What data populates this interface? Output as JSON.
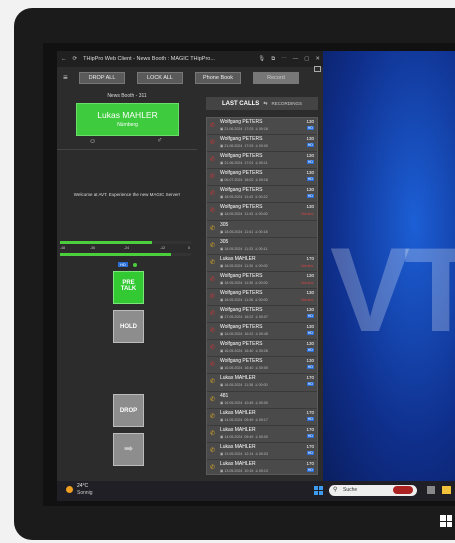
{
  "window": {
    "title": "THipPro Web Client - News Booth : MAGIC THipPro...",
    "toolbar": {
      "drop_all": "DROP ALL",
      "lock_all": "LOCK ALL",
      "phone_book": "Phone Book",
      "record": "Record"
    }
  },
  "booth": {
    "name": "News Booth - 311",
    "caller_name": "Lukas MAHLER",
    "caller_city": "Nürnberg"
  },
  "welcome": "Welcome at AVT. Experience the new MAGIC Server!",
  "meter": {
    "labels": [
      "-48",
      "-36",
      "-24",
      "-12",
      "0"
    ],
    "hd": "HD"
  },
  "controls": {
    "pretalk": "PRE\nTALK",
    "hold": "HOLD",
    "drop": "DROP"
  },
  "calls_header": {
    "title": "LAST CALLS",
    "tab": "RECORDINGS"
  },
  "calls": [
    {
      "name": "Wolfgang PETERS",
      "date": "21.06.2024",
      "time": "17:03",
      "dur": "00:18",
      "ext": "130",
      "tag": "HD",
      "icon": "in"
    },
    {
      "name": "Wolfgang PETERS",
      "date": "21.06.2024",
      "time": "17:03",
      "dur": "00:00",
      "ext": "130",
      "tag": "HD",
      "icon": "in"
    },
    {
      "name": "Wolfgang PETERS",
      "date": "21.06.2024",
      "time": "17:01",
      "dur": "00:11",
      "ext": "130",
      "tag": "HD",
      "icon": "in"
    },
    {
      "name": "Wolfgang PETERS",
      "date": "06.07.2024",
      "time": "18:02",
      "dur": "00:18",
      "ext": "130",
      "tag": "HD",
      "icon": "in"
    },
    {
      "name": "Wolfgang PETERS",
      "date": "18.05.2024",
      "time": "11:43",
      "dur": "00:22",
      "ext": "130",
      "tag": "HD",
      "icon": "in"
    },
    {
      "name": "Wolfgang PETERS",
      "date": "18.05.2024",
      "time": "11:43",
      "dur": "00:00",
      "ext": "130",
      "tag": "Not Ans.",
      "icon": "missed"
    },
    {
      "name": "305",
      "date": "18.05.2024",
      "time": "11:41",
      "dur": "00:18",
      "ext": "",
      "tag": "",
      "icon": "out"
    },
    {
      "name": "305",
      "date": "18.05.2024",
      "time": "11:33",
      "dur": "00:11",
      "ext": "",
      "tag": "",
      "icon": "out"
    },
    {
      "name": "Lukas MAHLER",
      "date": "18.05.2024",
      "time": "11:30",
      "dur": "00:00",
      "ext": "170",
      "tag": "Not Ans.",
      "icon": "out"
    },
    {
      "name": "Wolfgang PETERS",
      "date": "18.05.2024",
      "time": "11:30",
      "dur": "00:00",
      "ext": "130",
      "tag": "Not Ans.",
      "icon": "missed"
    },
    {
      "name": "Wolfgang PETERS",
      "date": "18.05.2024",
      "time": "11:26",
      "dur": "00:00",
      "ext": "130",
      "tag": "Not Ans.",
      "icon": "missed"
    },
    {
      "name": "Wolfgang PETERS",
      "date": "17.05.2024",
      "time": "16:22",
      "dur": "00:07",
      "ext": "130",
      "tag": "HD",
      "icon": "in"
    },
    {
      "name": "Wolfgang PETERS",
      "date": "16.05.2024",
      "time": "16:22",
      "dur": "00:45",
      "ext": "130",
      "tag": "HD",
      "icon": "in"
    },
    {
      "name": "Wolfgang PETERS",
      "date": "16.05.2024",
      "time": "16:40",
      "dur": "00:26",
      "ext": "130",
      "tag": "HD",
      "icon": "in"
    },
    {
      "name": "Wolfgang PETERS",
      "date": "16.05.2024",
      "time": "16:40",
      "dur": "00:00",
      "ext": "130",
      "tag": "HD",
      "icon": "in"
    },
    {
      "name": "Lukas MAHLER",
      "date": "16.05.2024",
      "time": "11:38",
      "dur": "00:00",
      "ext": "170",
      "tag": "HD",
      "icon": "out"
    },
    {
      "name": "481",
      "date": "16.05.2024",
      "time": "10:45",
      "dur": "00:00",
      "ext": "",
      "tag": "",
      "icon": "out"
    },
    {
      "name": "Lukas MAHLER",
      "date": "14.05.2024",
      "time": "09:49",
      "dur": "00:17",
      "ext": "170",
      "tag": "HD",
      "icon": "out"
    },
    {
      "name": "Lukas MAHLER",
      "date": "14.05.2024",
      "time": "09:49",
      "dur": "00:00",
      "ext": "170",
      "tag": "HD",
      "icon": "out"
    },
    {
      "name": "Lukas MAHLER",
      "date": "13.05.2024",
      "time": "12:14",
      "dur": "00:03",
      "ext": "170",
      "tag": "HD",
      "icon": "out"
    },
    {
      "name": "Lukas MAHLER",
      "date": "13.05.2024",
      "time": "10:15",
      "dur": "00:13",
      "ext": "170",
      "tag": "HD",
      "icon": "out"
    }
  ],
  "taskbar": {
    "temp": "24°C",
    "weather": "Sonnig",
    "search": "Suche"
  }
}
